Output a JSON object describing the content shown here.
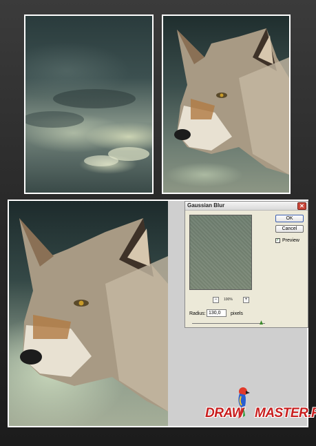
{
  "dialog": {
    "title": "Gaussian Blur",
    "close_symbol": "✕",
    "ok_label": "OK",
    "cancel_label": "Cancel",
    "preview_label": "Preview",
    "preview_checked": true,
    "zoom_out_symbol": "−",
    "zoom_in_symbol": "+",
    "zoom_level": "100%",
    "radius_label": "Radius:",
    "radius_value": "130,0",
    "radius_unit": "pixels"
  },
  "logo": {
    "part1": "DRAW",
    "part2": "MASTER.RU"
  },
  "colors": {
    "dialog_bg": "#ece9d8",
    "close_red": "#c9473a",
    "logo_red": "#c81e1e"
  }
}
